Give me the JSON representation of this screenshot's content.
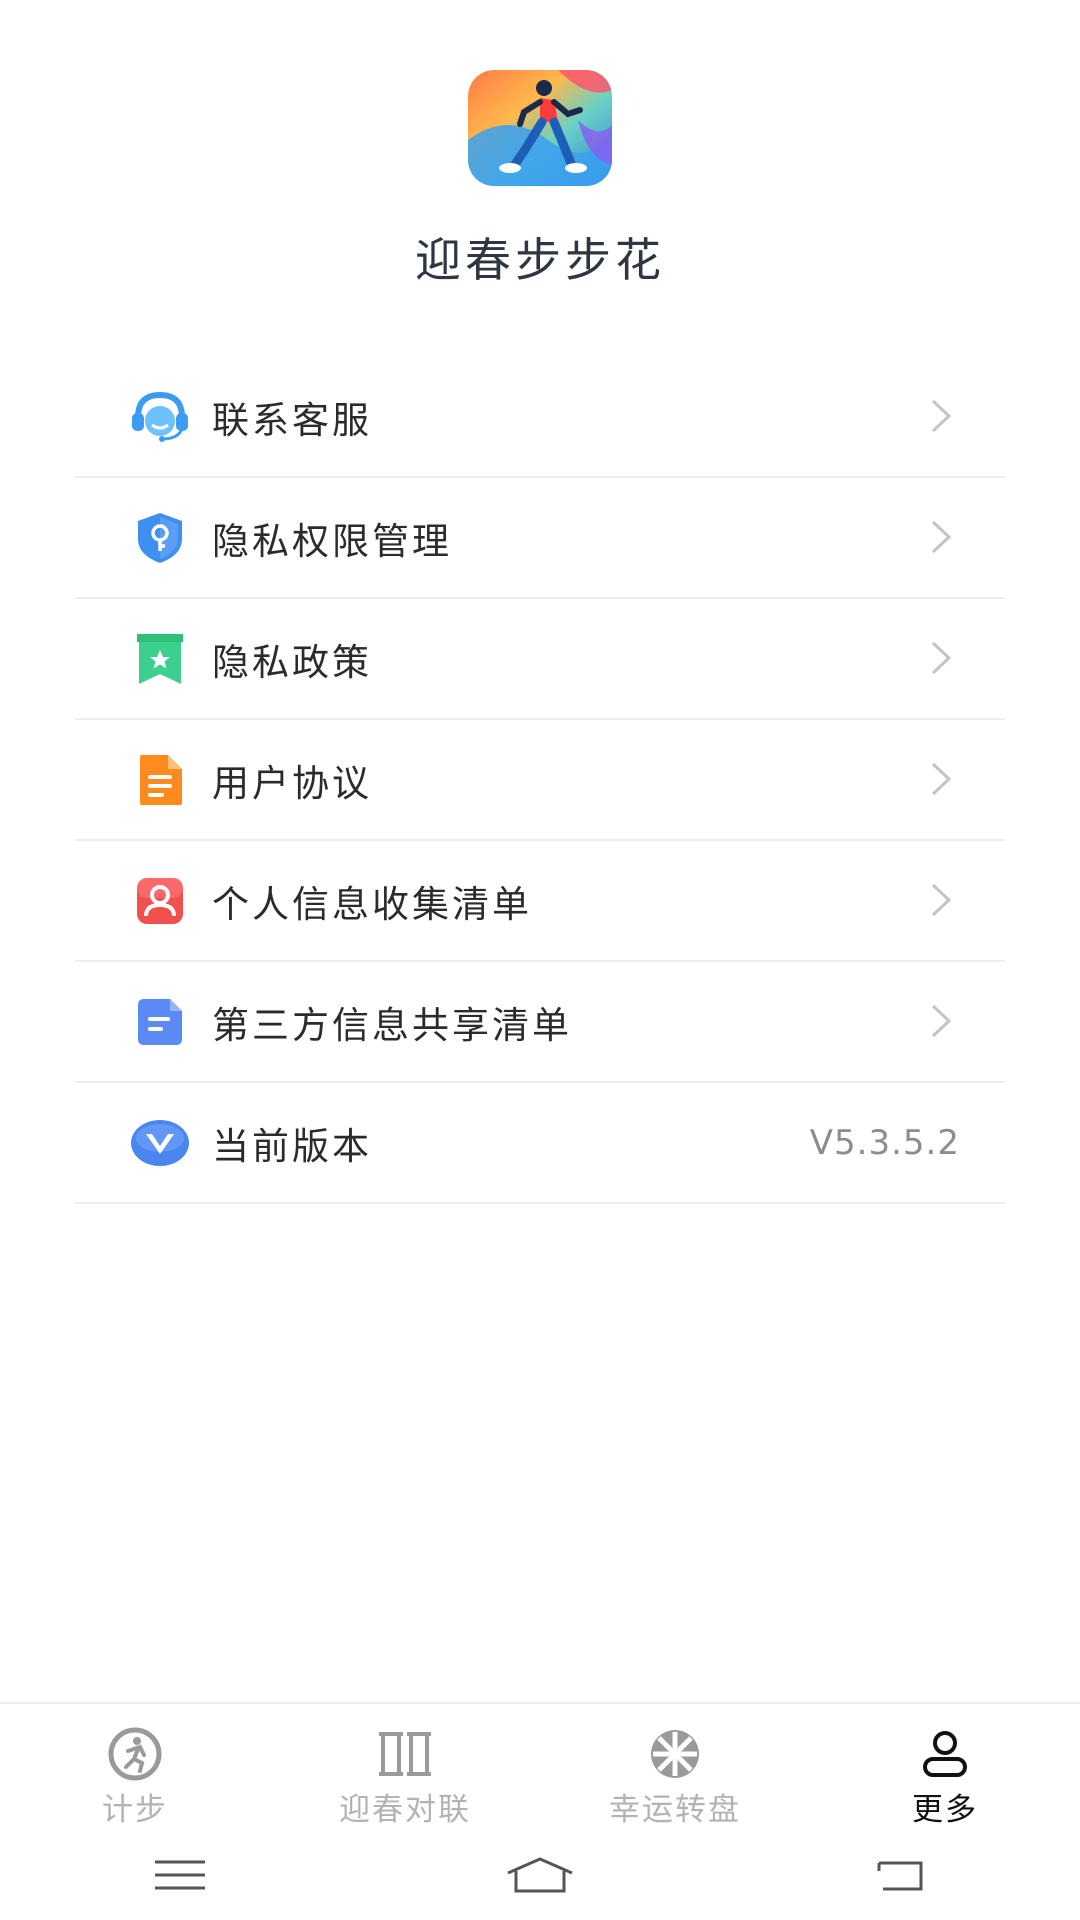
{
  "app": {
    "name": "迎春步步花",
    "logo_icon": "runner-logo-icon"
  },
  "menu": {
    "items": [
      {
        "label": "联系客服",
        "icon": "headset-icon",
        "icon_color": "#3b9cf2",
        "has_chevron": true
      },
      {
        "label": "隐私权限管理",
        "icon": "shield-key-icon",
        "icon_color": "#3d8ff0",
        "has_chevron": true
      },
      {
        "label": "隐私政策",
        "icon": "bookmark-star-icon",
        "icon_color": "#3ccf8e",
        "has_chevron": true
      },
      {
        "label": "用户协议",
        "icon": "document-icon",
        "icon_color": "#ff8a1f",
        "has_chevron": true
      },
      {
        "label": "个人信息收集清单",
        "icon": "person-card-icon",
        "icon_color": "#f24f4f",
        "has_chevron": true
      },
      {
        "label": "第三方信息共享清单",
        "icon": "file-lines-icon",
        "icon_color": "#5b8af5",
        "has_chevron": true
      },
      {
        "label": "当前版本",
        "icon": "version-v-icon",
        "icon_color": "#4a86f0",
        "value": "V5.3.5.2"
      }
    ]
  },
  "tabbar": {
    "tabs": [
      {
        "label": "计步",
        "icon": "step-counter-icon",
        "active": false
      },
      {
        "label": "迎春对联",
        "icon": "couplet-icon",
        "active": false
      },
      {
        "label": "幸运转盘",
        "icon": "wheel-icon",
        "active": false
      },
      {
        "label": "更多",
        "icon": "user-icon",
        "active": true
      }
    ]
  },
  "system_nav": {
    "buttons": [
      "menu-icon",
      "home-icon",
      "back-icon"
    ]
  },
  "colors": {
    "divider": "#ececec",
    "inactive_tab": "#b3b3b3",
    "active_tab": "#111111",
    "chevron": "#c4c4c4"
  }
}
